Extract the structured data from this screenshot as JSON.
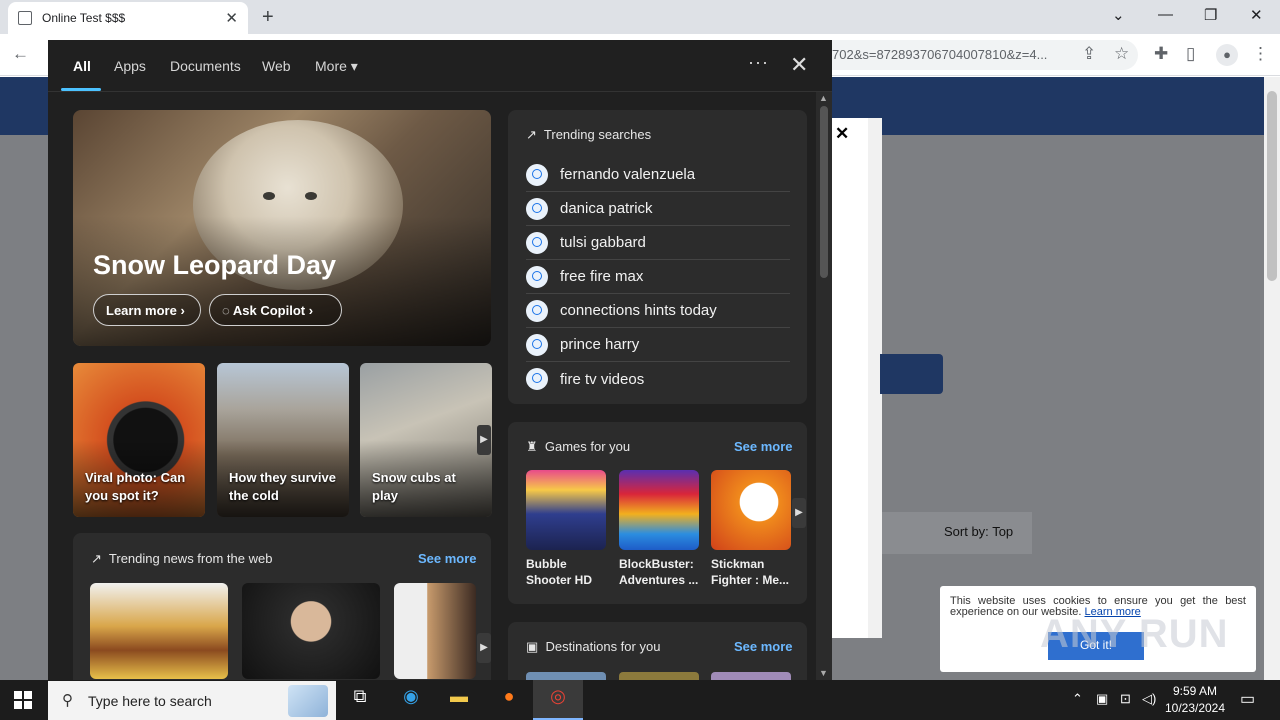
{
  "browser": {
    "tab_title": "Online Test $$$",
    "url_visible": "702&s=872893706704007810&z=4...",
    "new_tab": "+",
    "close_tab": "✕"
  },
  "page": {
    "sort_label": "Sort by:",
    "sort_value": "Top",
    "dialog_close": "✕",
    "cookie_text": "This website uses cookies to ensure you get the best experience on our website.",
    "cookie_link": "Learn more",
    "cookie_button": "Got it!",
    "watermark": "ANY RUN"
  },
  "search_panel": {
    "tabs": [
      "All",
      "Apps",
      "Documents",
      "Web",
      "More"
    ],
    "hero": {
      "title": "Snow Leopard Day",
      "learn_more": "Learn more",
      "ask_copilot": "Ask Copilot"
    },
    "thumbs": [
      {
        "caption": "Viral photo: Can you spot it?"
      },
      {
        "caption": "How they survive the cold"
      },
      {
        "caption": "Snow cubs at play"
      }
    ],
    "trending": {
      "title": "Trending searches",
      "items": [
        "fernando valenzuela",
        "danica patrick",
        "tulsi gabbard",
        "free fire max",
        "connections hints today",
        "prince harry",
        "fire tv videos"
      ]
    },
    "games": {
      "title": "Games for you",
      "see_more": "See more",
      "items": [
        {
          "title": "Bubble Shooter HD"
        },
        {
          "title": "BlockBuster: Adventures ..."
        },
        {
          "title": "Stickman Fighter : Me..."
        }
      ]
    },
    "news": {
      "title": "Trending news from the web",
      "see_more": "See more"
    },
    "destinations": {
      "title": "Destinations for you",
      "see_more": "See more"
    }
  },
  "taskbar": {
    "search_placeholder": "Type here to search",
    "time": "9:59 AM",
    "date": "10/23/2024"
  },
  "colors": {
    "accent": "#4cc2ff",
    "link": "#6cb8ff",
    "page_header": "#1f3763"
  }
}
